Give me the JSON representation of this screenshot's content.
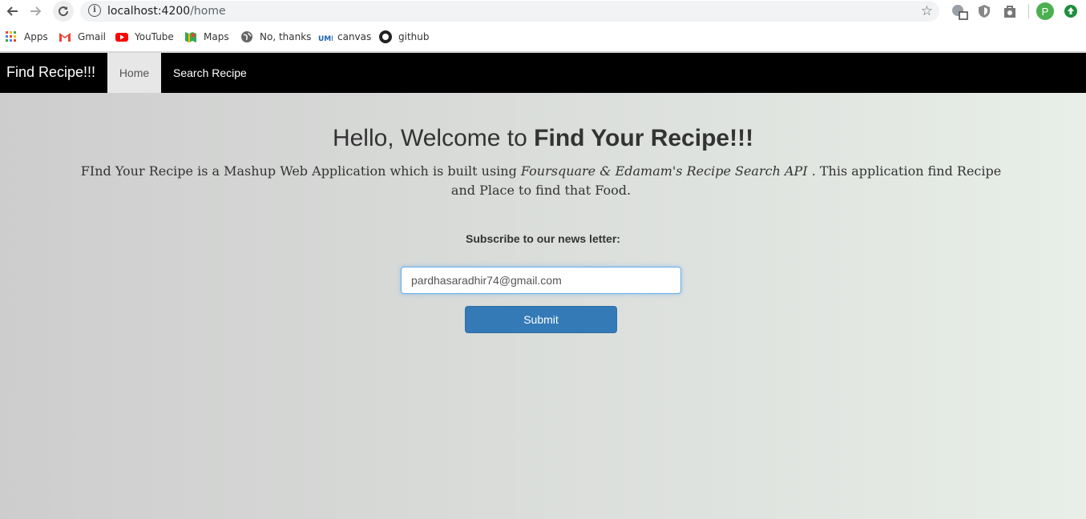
{
  "browser": {
    "url_host": "localhost:4200",
    "url_path": "/home",
    "bookmarks": [
      {
        "label": "Apps",
        "icon": "apps-grid-icon"
      },
      {
        "label": "Gmail",
        "icon": "gmail-icon"
      },
      {
        "label": "YouTube",
        "icon": "youtube-icon"
      },
      {
        "label": "Maps",
        "icon": "maps-icon"
      },
      {
        "label": "No, thanks",
        "icon": "globe-icon"
      },
      {
        "label": "canvas",
        "icon": "umkc-icon"
      },
      {
        "label": "github",
        "icon": "github-icon"
      }
    ],
    "profile_initial": "P"
  },
  "navbar": {
    "brand": "Find Recipe!!!",
    "home": "Home",
    "search": "Search Recipe"
  },
  "main": {
    "headline_prefix": "Hello, Welcome to ",
    "headline_bold": "Find Your Recipe!!!",
    "desc_part1": "FInd Your Recipe is a Mashup Web Application which is built using ",
    "desc_italic": "Foursquare & Edamam's Recipe Search API",
    "desc_part2": " . This application find Recipe and Place to find that Food.",
    "subscribe_label": "Subscribe to our news letter:",
    "email_value": "pardhasaradhir74@gmail.com",
    "submit_label": "Submit"
  },
  "colors": {
    "navbar_bg": "#000000",
    "active_tab_bg": "#e7e7e7",
    "submit_bg": "#337ab7"
  }
}
